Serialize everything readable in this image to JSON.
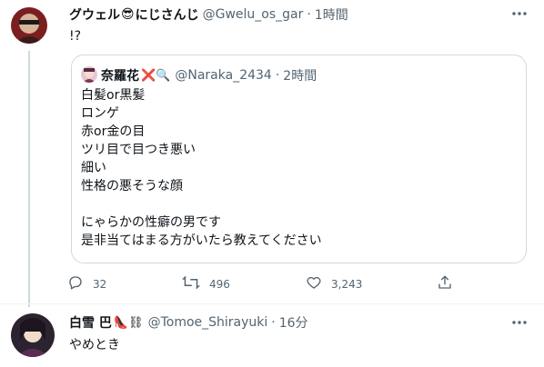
{
  "tweet": {
    "name": "グウェル",
    "name_emoji": "😎",
    "name_suffix": "にじさんじ",
    "handle": "@Gwelu_os_gar",
    "separator": "·",
    "time": "1時間",
    "text": "!?",
    "more_icon": "more-icon"
  },
  "quote": {
    "name": "奈羅花",
    "name_emojis": "❌🔍",
    "handle": "@Naraka_2434",
    "separator": "·",
    "time": "2時間",
    "lines": [
      "白髪or黒髪",
      "ロンゲ",
      "赤or金の目",
      "ツリ目で目つき悪い",
      "細い",
      "性格の悪そうな顔",
      "",
      "にゃらかの性癖の男です",
      "是非当てはまる方がいたら教えてください"
    ]
  },
  "actions": {
    "reply_count": "32",
    "retweet_count": "496",
    "like_count": "3,243"
  },
  "reply": {
    "name": "白雪 巴",
    "name_emojis": "👠⛓",
    "handle": "@Tomoe_Shirayuki",
    "separator": "·",
    "time": "16分",
    "text": "やめとき"
  },
  "colors": {
    "text": "#0f1419",
    "muted": "#536471",
    "border": "#cfd9de"
  }
}
